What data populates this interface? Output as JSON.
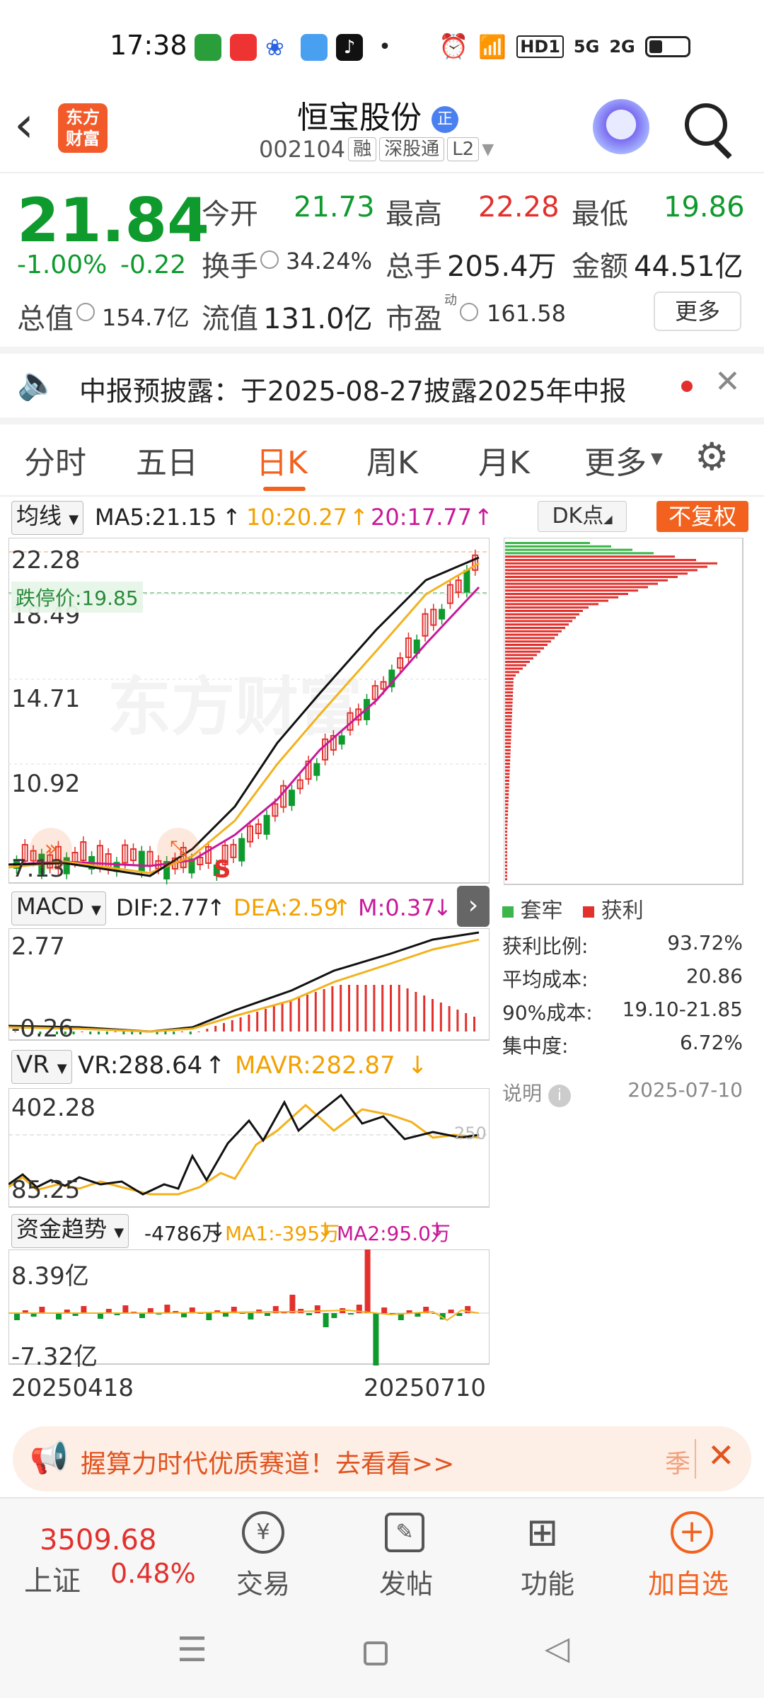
{
  "status_bar": {
    "time": "17:38",
    "hd": "HD1",
    "net1": "5G",
    "net2": "2G"
  },
  "header": {
    "brand_line1": "东方",
    "brand_line2": "财富",
    "title": "恒宝股份",
    "badge": "正",
    "code": "002104",
    "tags": [
      "融",
      "深股通",
      "L2"
    ]
  },
  "quote": {
    "price": "21.84",
    "change_pct": "-1.00%",
    "change": "-0.22",
    "open_label": "今开",
    "open": "21.73",
    "high_label": "最高",
    "high": "22.28",
    "low_label": "最低",
    "low": "19.86",
    "turnover_label": "换手",
    "turnover": "34.24%",
    "volume_label": "总手",
    "volume": "205.4万",
    "amount_label": "金额",
    "amount": "44.51亿",
    "mktcap_label": "总值",
    "mktcap": "154.7亿",
    "float_label": "流值",
    "float": "131.0亿",
    "pe_label": "市盈",
    "pe_sup": "动",
    "pe": "161.58",
    "more_button": "更多"
  },
  "notice": {
    "text": "中报预披露：于2025-08-27披露2025年中报"
  },
  "tabs": [
    "分时",
    "五日",
    "日K",
    "周K",
    "月K",
    "更多"
  ],
  "active_tab": "日K",
  "ma_row": {
    "selector": "均线",
    "ma5": "MA5:21.15",
    "ma10": "10:20.27",
    "ma20": "20:17.77",
    "dk": "DK点",
    "fq": "不复权"
  },
  "kline": {
    "y_labels": [
      "22.28",
      "18.49",
      "14.71",
      "10.92",
      "7.13"
    ],
    "limit_down_label": "跌停价:19.85",
    "watermark": "东方财富",
    "s_marker": "S"
  },
  "macd": {
    "selector": "MACD",
    "dif": "DIF:2.77",
    "dea": "DEA:2.59",
    "m": "M:0.37",
    "top": "2.77",
    "bottom": "-0.26"
  },
  "vr": {
    "selector": "VR",
    "vr": "VR:288.64",
    "mavr": "MAVR:282.87",
    "top": "402.28",
    "bottom": "85.25",
    "ref": "250"
  },
  "fund": {
    "selector": "资金趋势",
    "val": "-4786万",
    "ma1": "MA1:-395万",
    "ma2": "MA2:95.0万",
    "top": "8.39亿",
    "bottom": "-7.32亿"
  },
  "dates": {
    "start": "20250418",
    "end": "20250710"
  },
  "chip": {
    "legend_trap": "套牢",
    "legend_profit": "获利",
    "rows": [
      {
        "label": "获利比例:",
        "value": "93.72%"
      },
      {
        "label": "平均成本:",
        "value": "20.86"
      },
      {
        "label": "90%成本:",
        "value": "19.10-21.85"
      },
      {
        "label": "集中度:",
        "value": "6.72%"
      }
    ],
    "explain": "说明",
    "date": "2025-07-10"
  },
  "ad": {
    "text": "握算力时代优质赛道！去看看>>",
    "tail": "季"
  },
  "bottom_nav": {
    "index_value": "3509.68",
    "index_name": "上证",
    "index_pct": "0.48%",
    "items": [
      "交易",
      "发帖",
      "功能",
      "加自选"
    ]
  },
  "chart_data": {
    "type": "candlestick",
    "title": "恒宝股份 日K",
    "ylim": [
      7.13,
      22.28
    ],
    "x_range": [
      "20250418",
      "20250710"
    ],
    "ma": {
      "MA5": 21.15,
      "MA10": 20.27,
      "MA20": 17.77
    },
    "last_close": 21.84,
    "limit_down": 19.85
  }
}
